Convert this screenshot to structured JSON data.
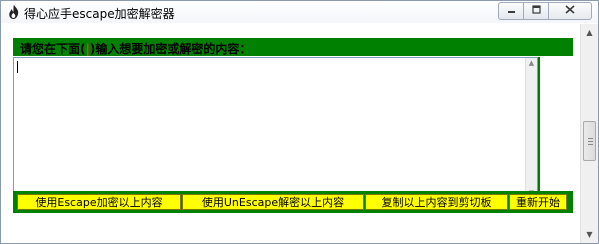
{
  "window": {
    "title": "得心应手escape加密解密器"
  },
  "header": {
    "label_before": "请您在下面(",
    "label_highlight": "|",
    "label_after": ")输入想要加密或解密的内容："
  },
  "editor": {
    "value": ""
  },
  "buttons": [
    {
      "label": "使用Escape加密以上内容"
    },
    {
      "label": "使用UnEscape解密以上内容"
    },
    {
      "label": "复制以上内容到剪切板"
    },
    {
      "label": "重新开始"
    }
  ],
  "colors": {
    "header_green": "#008000",
    "button_yellow": "#ffff00",
    "highlight_red": "#ff2a2a"
  },
  "icons": {
    "app": "flame-icon",
    "minimize": "minimize-icon",
    "maximize": "maximize-icon",
    "close": "close-icon"
  }
}
